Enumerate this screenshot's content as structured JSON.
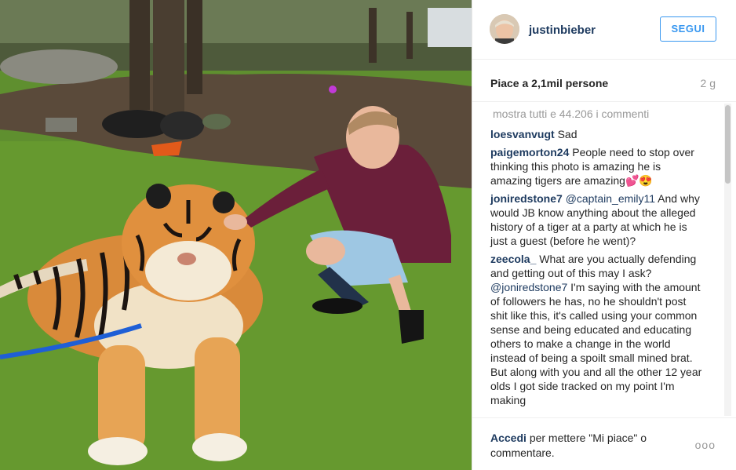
{
  "post": {
    "photo_alt": "",
    "username": "justinbieber",
    "follow_label": "SEGUI",
    "likes_text": "Piace a 2,1mil persone",
    "time_ago": "2 g",
    "view_all": "mostra tutti e 44.206 i commenti",
    "comments": [
      {
        "author": "loesvanvugt",
        "mention": "",
        "text": "Sad"
      },
      {
        "author": "paigemorton24",
        "mention": "",
        "text": "People need to stop over thinking this photo is amazing he is amazing tigers are amazing💕😍"
      },
      {
        "author": "joniredstone7",
        "mention": "@captain_emily11",
        "text": "And why would JB know anything about the alleged history of a tiger at a party at which he is just a guest (before he went)?"
      },
      {
        "author": "zeecola_",
        "mention": "",
        "text": "What are you actually defending and getting out of this may I ask?"
      },
      {
        "author": "",
        "mention": "@joniredstone7",
        "text": "I'm saying with the amount of followers he has, no he shouldn't post shit like this, it's called using your common sense and being educated and educating others to make a change in the world instead of being a spoilt small mined brat. But along with you and all the other 12 year olds I got side tracked on my point I'm making"
      }
    ],
    "footer_login": "Accedi",
    "footer_rest": "per mettere \"Mi piace\" o commentare.",
    "more_icon": "ooo"
  }
}
